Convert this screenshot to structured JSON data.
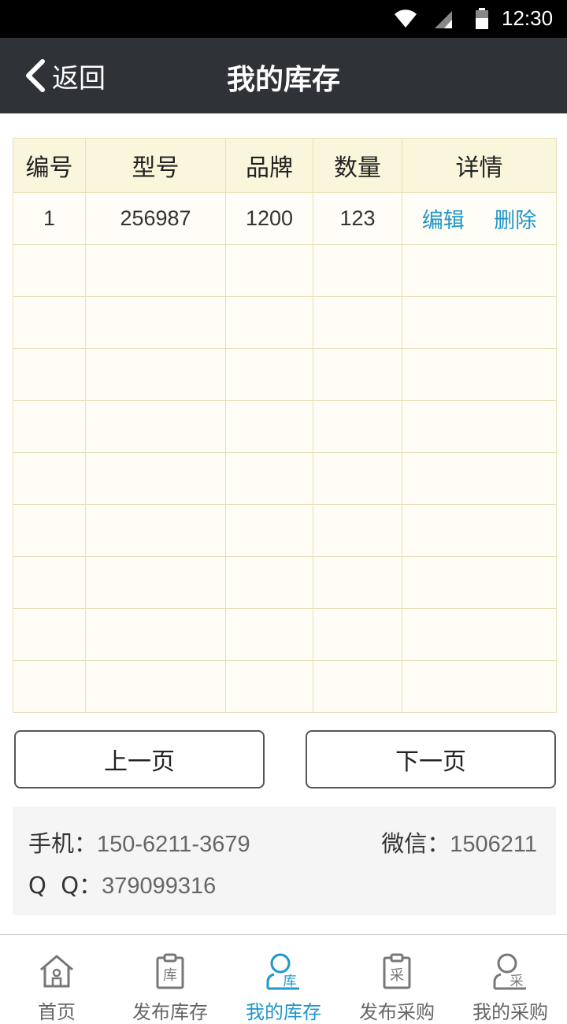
{
  "status_bar": {
    "time": "12:30"
  },
  "header": {
    "back_label": "返回",
    "title": "我的库存"
  },
  "table": {
    "headers": [
      "编号",
      "型号",
      "品牌",
      "数量",
      "详情"
    ],
    "rows": [
      {
        "id": "1",
        "model": "256987",
        "brand": "1200",
        "quantity": "123",
        "edit": "编辑",
        "delete": "删除"
      }
    ]
  },
  "pagination": {
    "prev": "上一页",
    "next": "下一页"
  },
  "contact": {
    "phone_label": "手机：",
    "phone": "150-6211-3679",
    "wechat_label": "微信：",
    "wechat": "1506211",
    "qq_label": "Q  Q：",
    "qq": "379099316"
  },
  "bottom_nav": {
    "items": [
      {
        "label": "首页",
        "icon": "home-icon",
        "active": false
      },
      {
        "label": "发布库存",
        "icon": "clipboard-ku-icon",
        "active": false,
        "icon_char": "库"
      },
      {
        "label": "我的库存",
        "icon": "user-ku-icon",
        "active": true,
        "icon_char": "库"
      },
      {
        "label": "发布采购",
        "icon": "clipboard-cai-icon",
        "active": false,
        "icon_char": "采"
      },
      {
        "label": "我的采购",
        "icon": "user-cai-icon",
        "active": false,
        "icon_char": "采"
      }
    ]
  },
  "colors": {
    "accent": "#1f97c9",
    "header_bg": "#2f3337",
    "table_header_bg": "#faf6dc"
  }
}
